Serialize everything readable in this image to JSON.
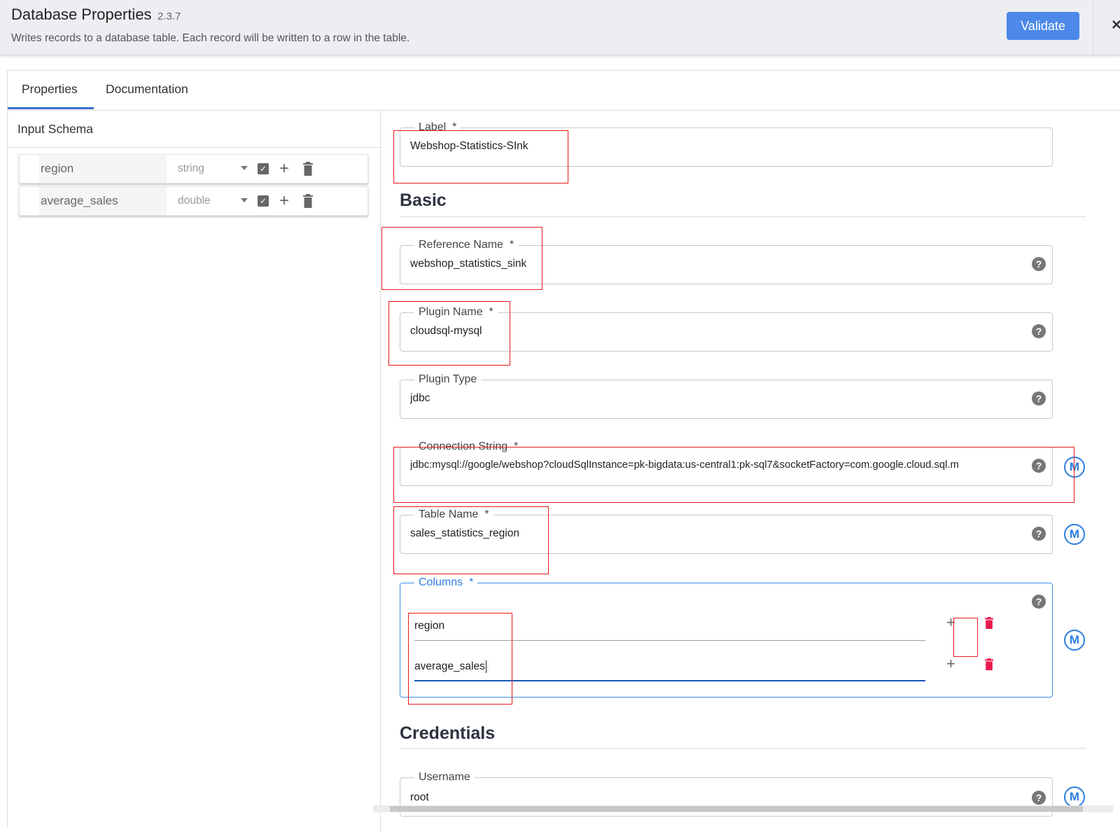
{
  "header": {
    "title": "Database Properties",
    "version": "2.3.7",
    "description": "Writes records to a database table. Each record will be written to a row in the table.",
    "validate_label": "Validate",
    "close_glyph": "×"
  },
  "tabs": [
    {
      "label": "Properties",
      "active": true
    },
    {
      "label": "Documentation",
      "active": false
    }
  ],
  "input_schema": {
    "title": "Input Schema",
    "fields": [
      {
        "name": "region",
        "type": "string",
        "nullable_checked": true
      },
      {
        "name": "average_sales",
        "type": "double",
        "nullable_checked": true
      }
    ]
  },
  "form": {
    "label": {
      "label": "Label",
      "required_mark": "*",
      "value": "Webshop-Statistics-SInk"
    },
    "basic_title": "Basic",
    "reference_name": {
      "label": "Reference Name",
      "required_mark": "*",
      "value": "webshop_statistics_sink"
    },
    "plugin_name": {
      "label": "Plugin Name",
      "required_mark": "*",
      "value": "cloudsql-mysql"
    },
    "plugin_type": {
      "label": "Plugin Type",
      "value": "jdbc"
    },
    "connection_string": {
      "label": "Connection String",
      "required_mark": "*",
      "value": "jdbc:mysql://google/webshop?cloudSqlInstance=pk-bigdata:us-central1:pk-sql7&socketFactory=com.google.cloud.sql.m"
    },
    "table_name": {
      "label": "Table Name",
      "required_mark": "*",
      "value": "sales_statistics_region"
    },
    "columns": {
      "label": "Columns",
      "required_mark": "*",
      "values": [
        "region",
        "average_sales"
      ]
    },
    "credentials_title": "Credentials",
    "username": {
      "label": "Username",
      "value": "root"
    }
  },
  "icons": {
    "help": "?",
    "macro": "M",
    "plus": "+",
    "check": "✓"
  },
  "colors": {
    "accent": "#4c89e8",
    "macro_blue": "#2b7de0",
    "delete_red": "#e8184a",
    "highlight_red": "#e81a1a"
  }
}
